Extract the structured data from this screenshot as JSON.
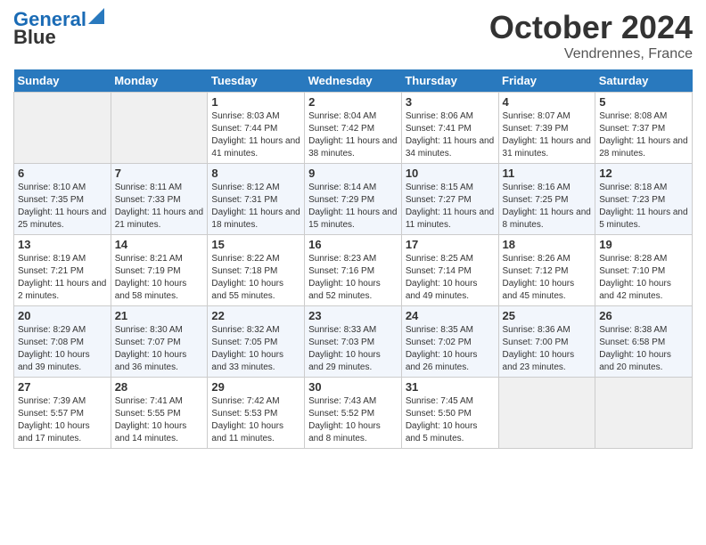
{
  "logo": {
    "line1": "General",
    "line2": "Blue"
  },
  "title": "October 2024",
  "location": "Vendrennes, France",
  "days_of_week": [
    "Sunday",
    "Monday",
    "Tuesday",
    "Wednesday",
    "Thursday",
    "Friday",
    "Saturday"
  ],
  "weeks": [
    [
      {
        "day": "",
        "info": ""
      },
      {
        "day": "",
        "info": ""
      },
      {
        "day": "1",
        "info": "Sunrise: 8:03 AM\nSunset: 7:44 PM\nDaylight: 11 hours and 41 minutes."
      },
      {
        "day": "2",
        "info": "Sunrise: 8:04 AM\nSunset: 7:42 PM\nDaylight: 11 hours and 38 minutes."
      },
      {
        "day": "3",
        "info": "Sunrise: 8:06 AM\nSunset: 7:41 PM\nDaylight: 11 hours and 34 minutes."
      },
      {
        "day": "4",
        "info": "Sunrise: 8:07 AM\nSunset: 7:39 PM\nDaylight: 11 hours and 31 minutes."
      },
      {
        "day": "5",
        "info": "Sunrise: 8:08 AM\nSunset: 7:37 PM\nDaylight: 11 hours and 28 minutes."
      }
    ],
    [
      {
        "day": "6",
        "info": "Sunrise: 8:10 AM\nSunset: 7:35 PM\nDaylight: 11 hours and 25 minutes."
      },
      {
        "day": "7",
        "info": "Sunrise: 8:11 AM\nSunset: 7:33 PM\nDaylight: 11 hours and 21 minutes."
      },
      {
        "day": "8",
        "info": "Sunrise: 8:12 AM\nSunset: 7:31 PM\nDaylight: 11 hours and 18 minutes."
      },
      {
        "day": "9",
        "info": "Sunrise: 8:14 AM\nSunset: 7:29 PM\nDaylight: 11 hours and 15 minutes."
      },
      {
        "day": "10",
        "info": "Sunrise: 8:15 AM\nSunset: 7:27 PM\nDaylight: 11 hours and 11 minutes."
      },
      {
        "day": "11",
        "info": "Sunrise: 8:16 AM\nSunset: 7:25 PM\nDaylight: 11 hours and 8 minutes."
      },
      {
        "day": "12",
        "info": "Sunrise: 8:18 AM\nSunset: 7:23 PM\nDaylight: 11 hours and 5 minutes."
      }
    ],
    [
      {
        "day": "13",
        "info": "Sunrise: 8:19 AM\nSunset: 7:21 PM\nDaylight: 11 hours and 2 minutes."
      },
      {
        "day": "14",
        "info": "Sunrise: 8:21 AM\nSunset: 7:19 PM\nDaylight: 10 hours and 58 minutes."
      },
      {
        "day": "15",
        "info": "Sunrise: 8:22 AM\nSunset: 7:18 PM\nDaylight: 10 hours and 55 minutes."
      },
      {
        "day": "16",
        "info": "Sunrise: 8:23 AM\nSunset: 7:16 PM\nDaylight: 10 hours and 52 minutes."
      },
      {
        "day": "17",
        "info": "Sunrise: 8:25 AM\nSunset: 7:14 PM\nDaylight: 10 hours and 49 minutes."
      },
      {
        "day": "18",
        "info": "Sunrise: 8:26 AM\nSunset: 7:12 PM\nDaylight: 10 hours and 45 minutes."
      },
      {
        "day": "19",
        "info": "Sunrise: 8:28 AM\nSunset: 7:10 PM\nDaylight: 10 hours and 42 minutes."
      }
    ],
    [
      {
        "day": "20",
        "info": "Sunrise: 8:29 AM\nSunset: 7:08 PM\nDaylight: 10 hours and 39 minutes."
      },
      {
        "day": "21",
        "info": "Sunrise: 8:30 AM\nSunset: 7:07 PM\nDaylight: 10 hours and 36 minutes."
      },
      {
        "day": "22",
        "info": "Sunrise: 8:32 AM\nSunset: 7:05 PM\nDaylight: 10 hours and 33 minutes."
      },
      {
        "day": "23",
        "info": "Sunrise: 8:33 AM\nSunset: 7:03 PM\nDaylight: 10 hours and 29 minutes."
      },
      {
        "day": "24",
        "info": "Sunrise: 8:35 AM\nSunset: 7:02 PM\nDaylight: 10 hours and 26 minutes."
      },
      {
        "day": "25",
        "info": "Sunrise: 8:36 AM\nSunset: 7:00 PM\nDaylight: 10 hours and 23 minutes."
      },
      {
        "day": "26",
        "info": "Sunrise: 8:38 AM\nSunset: 6:58 PM\nDaylight: 10 hours and 20 minutes."
      }
    ],
    [
      {
        "day": "27",
        "info": "Sunrise: 7:39 AM\nSunset: 5:57 PM\nDaylight: 10 hours and 17 minutes."
      },
      {
        "day": "28",
        "info": "Sunrise: 7:41 AM\nSunset: 5:55 PM\nDaylight: 10 hours and 14 minutes."
      },
      {
        "day": "29",
        "info": "Sunrise: 7:42 AM\nSunset: 5:53 PM\nDaylight: 10 hours and 11 minutes."
      },
      {
        "day": "30",
        "info": "Sunrise: 7:43 AM\nSunset: 5:52 PM\nDaylight: 10 hours and 8 minutes."
      },
      {
        "day": "31",
        "info": "Sunrise: 7:45 AM\nSunset: 5:50 PM\nDaylight: 10 hours and 5 minutes."
      },
      {
        "day": "",
        "info": ""
      },
      {
        "day": "",
        "info": ""
      }
    ]
  ]
}
